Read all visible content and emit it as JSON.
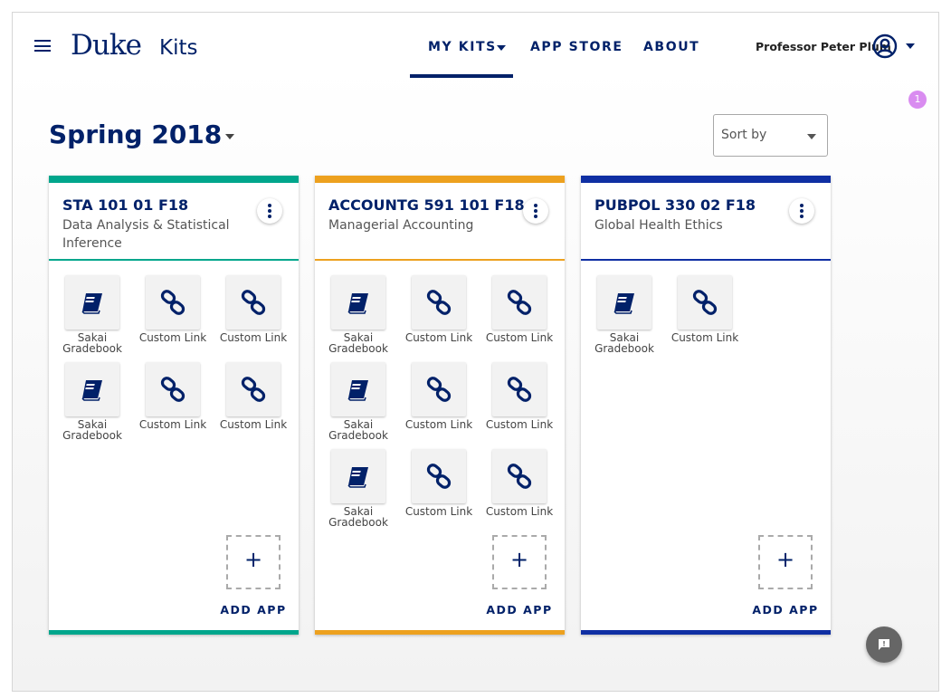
{
  "header": {
    "logo_primary": "Duke",
    "logo_secondary": "Kits",
    "nav": {
      "my_kits": "MY KITS",
      "app_store": "APP STORE",
      "about": "ABOUT"
    },
    "user_name": "Professor Peter Plum",
    "notification_count": "1"
  },
  "semester": {
    "title": "Spring 2018"
  },
  "sort": {
    "placeholder": "Sort by"
  },
  "colors": {
    "brand": "#012169",
    "green": "#00a68c",
    "orange": "#eda11f",
    "blue": "#0f2fa3",
    "badge": "#d98cf0"
  },
  "cards": [
    {
      "code": "STA 101 01 F18",
      "name": "Data Analysis & Statistical Inference",
      "accent": "#00a68c",
      "apps": [
        {
          "label": "Sakai Gradebook",
          "icon": "book-icon"
        },
        {
          "label": "Custom Link",
          "icon": "link-icon"
        },
        {
          "label": "Custom Link",
          "icon": "link-icon"
        },
        {
          "label": "Sakai Gradebook",
          "icon": "book-icon"
        },
        {
          "label": "Custom Link",
          "icon": "link-icon"
        },
        {
          "label": "Custom Link",
          "icon": "link-icon"
        }
      ],
      "add_label": "ADD APP"
    },
    {
      "code": "ACCOUNTG 591 101 F18",
      "name": "Managerial Accounting",
      "accent": "#eda11f",
      "apps": [
        {
          "label": "Sakai Gradebook",
          "icon": "book-icon"
        },
        {
          "label": "Custom Link",
          "icon": "link-icon"
        },
        {
          "label": "Custom Link",
          "icon": "link-icon"
        },
        {
          "label": "Sakai Gradebook",
          "icon": "book-icon"
        },
        {
          "label": "Custom Link",
          "icon": "link-icon"
        },
        {
          "label": "Custom Link",
          "icon": "link-icon"
        },
        {
          "label": "Sakai Gradebook",
          "icon": "book-icon"
        },
        {
          "label": "Custom Link",
          "icon": "link-icon"
        },
        {
          "label": "Custom Link",
          "icon": "link-icon"
        }
      ],
      "add_label": "ADD APP"
    },
    {
      "code": "PUBPOL 330 02 F18",
      "name": "Global Health Ethics",
      "accent": "#0f2fa3",
      "apps": [
        {
          "label": "Sakai Gradebook",
          "icon": "book-icon"
        },
        {
          "label": "Custom Link",
          "icon": "link-icon"
        }
      ],
      "add_label": "ADD APP"
    }
  ]
}
